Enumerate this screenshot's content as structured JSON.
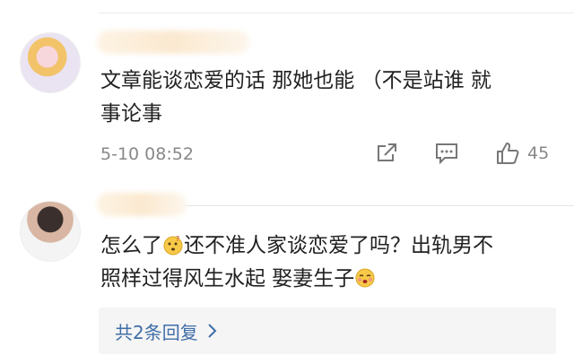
{
  "comments": [
    {
      "text_line1": "文章能谈恋爱的话 那她也能 （不是站谁 就",
      "text_line2": "事论事",
      "time": "5-10 08:52",
      "like_count": "45",
      "icons": [
        "share-icon",
        "reply-icon",
        "thumbs-up-icon"
      ]
    },
    {
      "text_a": "怎么了",
      "text_b": "还不准人家谈恋爱了吗？出轨男不",
      "text_c": "照样过得风生水起 娶妻生子",
      "emojis": [
        "confused-face-emoji",
        "blushing-face-emoji"
      ]
    }
  ],
  "replies": {
    "label": "共2条回复"
  },
  "colors": {
    "link": "#3f6ea8",
    "meta": "#888888",
    "text": "#222222",
    "reply_bg": "#f5f5f5"
  }
}
